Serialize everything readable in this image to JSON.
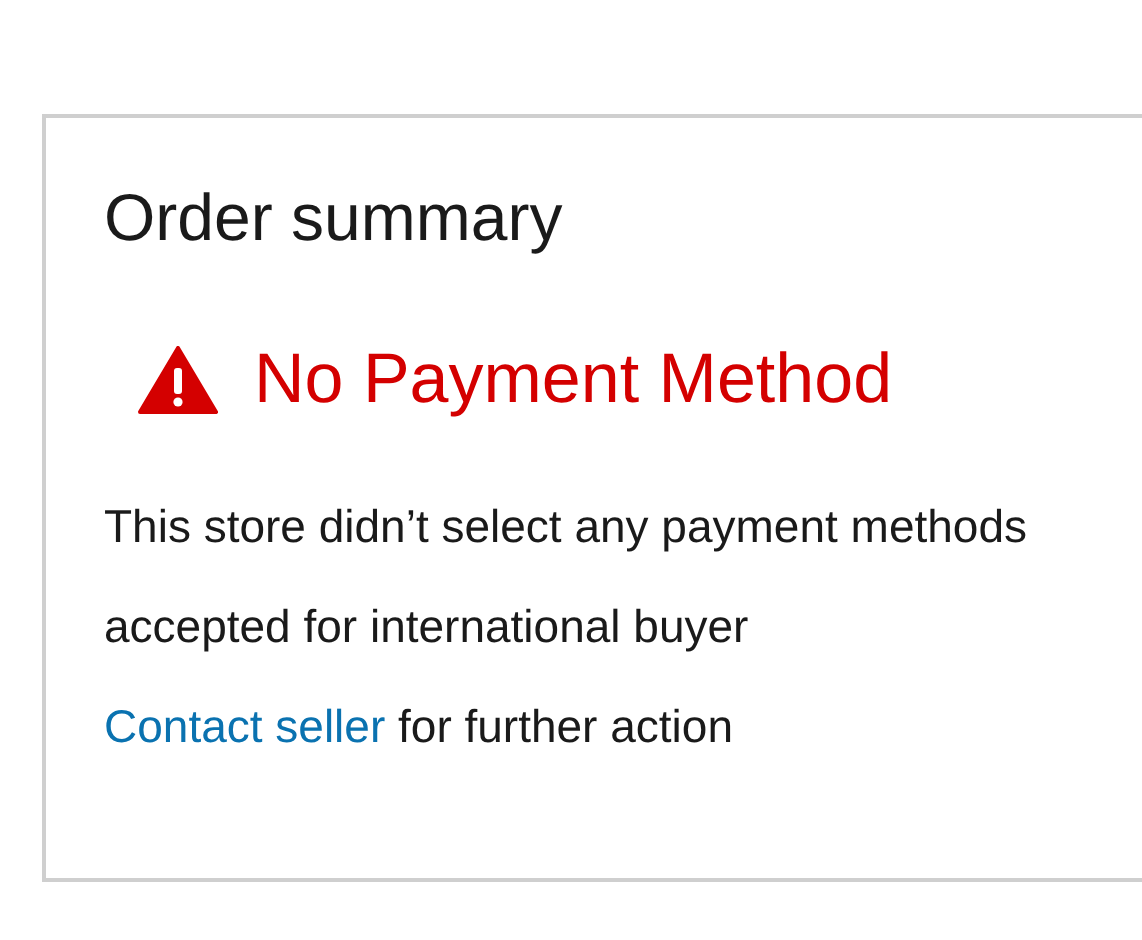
{
  "card": {
    "title": "Order summary",
    "alert": {
      "kind": "error",
      "text": "No Payment Method"
    },
    "message": "This store didn’t select any payment methods accepted for international buyer",
    "link": "Contact seller",
    "after_link": "for further action"
  }
}
